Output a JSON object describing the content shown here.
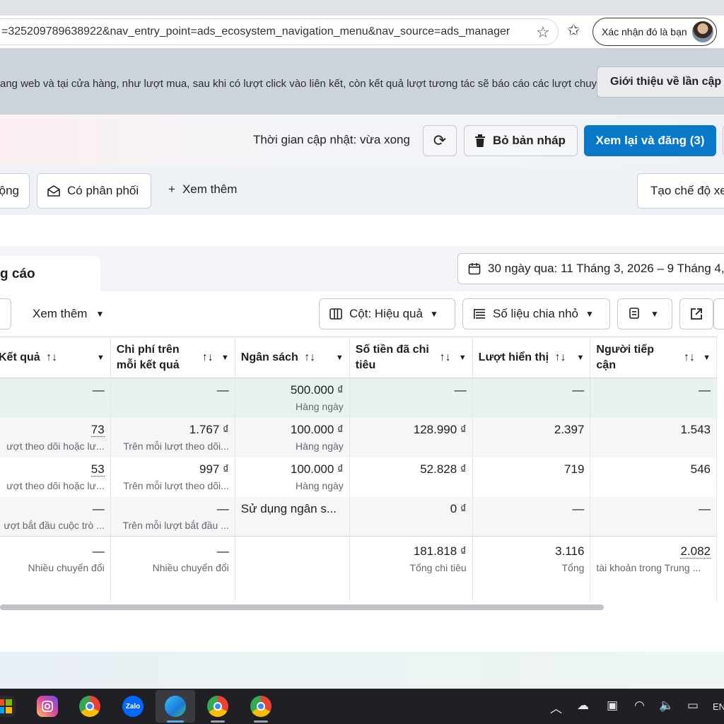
{
  "browser": {
    "url": "=325209789638922&nav_entry_point=ads_ecosystem_navigation_menu&nav_source=ads_manager",
    "profile_label": "Xác nhận đó là bạn"
  },
  "banner": {
    "text": "ang web và tại cửa hàng, như lượt mua, sau khi có lượt click vào liên kết, còn kết quả lượt tương tác sẽ báo cáo các lượt chuyển",
    "button": "Giới thiệu về lần cập"
  },
  "toolbar": {
    "updated": "Thời gian cập nhật: vừa xong",
    "discard": "Bỏ bản nháp",
    "publish": "Xem lại và đăng (3)"
  },
  "filters": {
    "chip_a": "ộng",
    "chip_b": "Có phân phối",
    "more": "Xem thêm",
    "create_view": "Tạo chế độ xe"
  },
  "tabs": {
    "active": "g cáo",
    "date_range": "30 ngày qua: 11 Tháng 3, 2026 – 9 Tháng 4,"
  },
  "controls": {
    "see_more": "Xem thêm",
    "columns": "Cột: Hiệu quả",
    "breakdown": "Số liệu chia nhỏ"
  },
  "table": {
    "headers": [
      "Kết quả",
      "Chi phí trên mỗi kết quả",
      "Ngân sách",
      "Số tiền đã chi tiêu",
      "Lượt hiển thị",
      "Người tiếp cận"
    ],
    "rows": [
      {
        "results": "—",
        "results_sub": "",
        "cpr": "—",
        "cpr_sub": "",
        "budget": "500.000 ₫",
        "budget_sub": "Hàng ngày",
        "spent": "—",
        "impr": "—",
        "reach": "—"
      },
      {
        "results": "73",
        "results_sub": "ượt theo dõi hoặc lư...",
        "cpr": "1.767 ₫",
        "cpr_sub": "Trên mỗi lượt theo dõi...",
        "budget": "100.000 ₫",
        "budget_sub": "Hàng ngày",
        "spent": "128.990 ₫",
        "impr": "2.397",
        "reach": "1.543"
      },
      {
        "results": "53",
        "results_sub": "ượt theo dõi hoặc lư...",
        "cpr": "997 ₫",
        "cpr_sub": "Trên mỗi lượt theo dõi...",
        "budget": "100.000 ₫",
        "budget_sub": "Hàng ngày",
        "spent": "52.828 ₫",
        "impr": "719",
        "reach": "546"
      },
      {
        "results": "—",
        "results_sub": "ượt bắt đầu cuộc trò ...",
        "cpr": "—",
        "cpr_sub": "Trên mỗi lượt bắt đầu ...",
        "budget": "Sử dụng ngân s...",
        "budget_sub": "",
        "spent": "0 ₫",
        "impr": "—",
        "reach": "—"
      }
    ],
    "total": {
      "results": "—",
      "results_sub": "Nhiều chuyển đổi",
      "cpr": "—",
      "cpr_sub": "Nhiều chuyển đổi",
      "spent": "181.818 ₫",
      "spent_sub": "Tổng chi tiêu",
      "impr": "3.116",
      "impr_sub": "Tổng",
      "reach": "2.082",
      "reach_sub": "tài khoản trong Trung ..."
    }
  },
  "taskbar": {
    "zalo_label": "Zalo",
    "lang": "EN"
  }
}
